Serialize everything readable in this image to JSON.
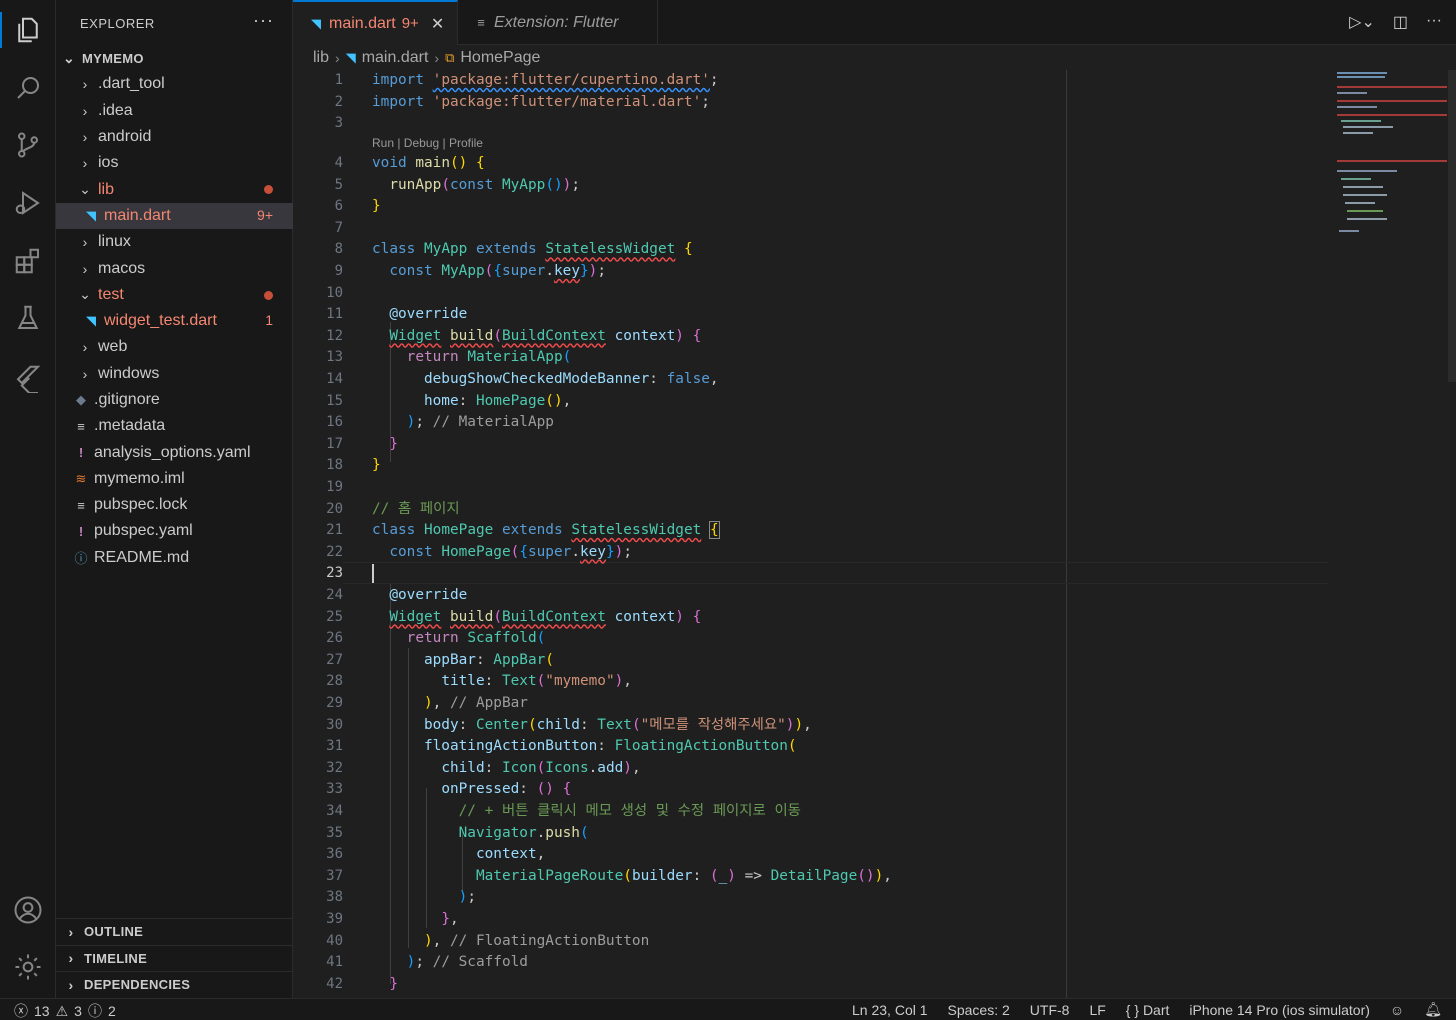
{
  "sidebar": {
    "title": "EXPLORER",
    "more": "···",
    "project": "MYMEMO",
    "items": [
      {
        "label": ".dart_tool",
        "type": "folder"
      },
      {
        "label": ".idea",
        "type": "folder"
      },
      {
        "label": "android",
        "type": "folder"
      },
      {
        "label": "ios",
        "type": "folder"
      },
      {
        "label": "lib",
        "type": "folder-open",
        "error": true
      },
      {
        "label": "main.dart",
        "type": "dart",
        "error": true,
        "badge": "9+"
      },
      {
        "label": "linux",
        "type": "folder"
      },
      {
        "label": "macos",
        "type": "folder"
      },
      {
        "label": "test",
        "type": "folder-open",
        "error": true
      },
      {
        "label": "widget_test.dart",
        "type": "dart",
        "error": true,
        "badge": "1"
      },
      {
        "label": "web",
        "type": "folder"
      },
      {
        "label": "windows",
        "type": "folder"
      },
      {
        "label": ".gitignore",
        "type": "git"
      },
      {
        "label": ".metadata",
        "type": "lines"
      },
      {
        "label": "analysis_options.yaml",
        "type": "yaml"
      },
      {
        "label": "mymemo.iml",
        "type": "rss"
      },
      {
        "label": "pubspec.lock",
        "type": "lines"
      },
      {
        "label": "pubspec.yaml",
        "type": "yaml"
      },
      {
        "label": "README.md",
        "type": "info"
      }
    ],
    "sections": [
      "OUTLINE",
      "TIMELINE",
      "DEPENDENCIES"
    ]
  },
  "tabs": [
    {
      "label": "main.dart",
      "badge": "9+",
      "close": "✕"
    },
    {
      "label": "Extension: Flutter"
    }
  ],
  "breadcrumb": [
    "lib",
    "main.dart",
    "HomePage"
  ],
  "codelens": "Run | Debug | Profile",
  "line_numbers": [
    "1",
    "2",
    "3",
    "4",
    "5",
    "6",
    "7",
    "8",
    "9",
    "10",
    "11",
    "12",
    "13",
    "14",
    "15",
    "16",
    "17",
    "18",
    "19",
    "20",
    "21",
    "22",
    "23",
    "24",
    "25",
    "26",
    "27",
    "28",
    "29",
    "30",
    "31",
    "32",
    "33",
    "34",
    "35",
    "36",
    "37",
    "38",
    "39",
    "40",
    "41",
    "42"
  ],
  "current_line": "23",
  "strings": {
    "imp1": "'package:flutter/cupertino.dart'",
    "imp2": "'package:flutter/material.dart'",
    "mymemo": "\"mymemo\"",
    "body_text": "\"메모를 작성해주세요\"",
    "cmt_home": "// 홈 페이지",
    "cmt_nav": "// + 버튼 클릭시 메모 생성 및 수정 페이지로 이동",
    "cmt_materialapp": "// MaterialApp",
    "cmt_appbar": "// AppBar",
    "cmt_fab": "// FloatingActionButton",
    "cmt_scaffold": "// Scaffold"
  },
  "status": {
    "errors": "13",
    "warnings": "3",
    "infos": "2",
    "position": "Ln 23, Col 1",
    "spaces": "Spaces: 2",
    "encoding": "UTF-8",
    "eol": "LF",
    "language": "Dart",
    "device": "iPhone 14 Pro (ios simulator)"
  },
  "colors": {
    "accent": "#0078d4",
    "error": "#f48771",
    "keyword": "#569cd6",
    "type": "#4ec9b0",
    "string": "#ce9178",
    "comment": "#6a9955"
  }
}
